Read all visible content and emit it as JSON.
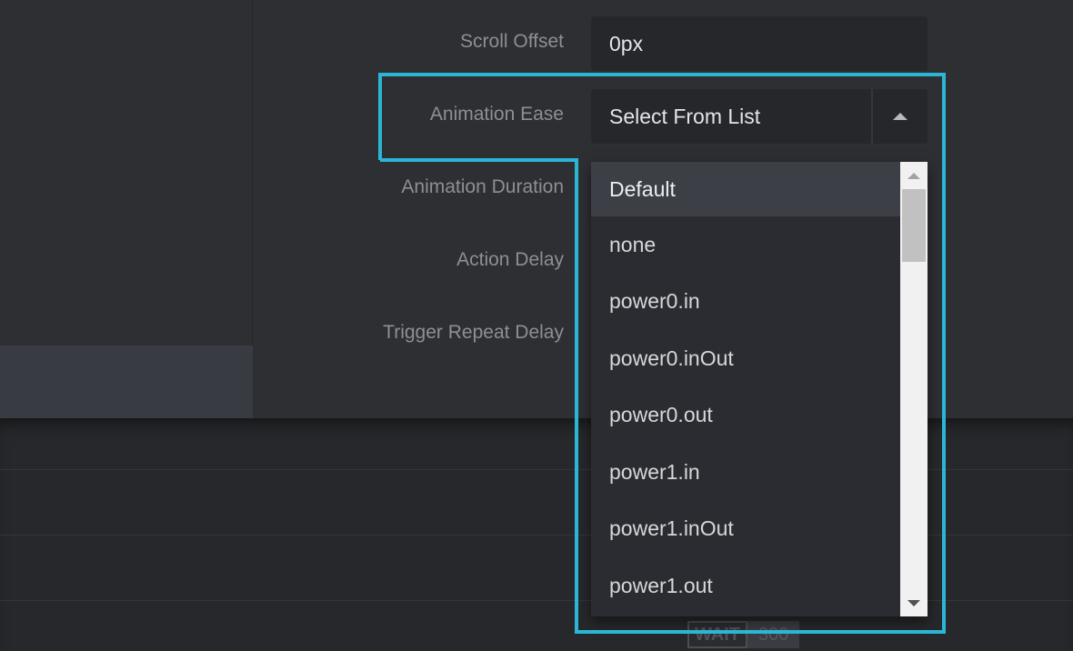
{
  "form": {
    "scroll_offset_label": "Scroll Offset",
    "scroll_offset_value": "0px",
    "animation_ease_label": "Animation Ease",
    "animation_ease_value": "Select From List",
    "animation_duration_label": "Animation Duration",
    "action_delay_label": "Action Delay",
    "trigger_repeat_delay_label": "Trigger Repeat Delay"
  },
  "dropdown": {
    "options": [
      "Default",
      "none",
      "power0.in",
      "power0.inOut",
      "power0.out",
      "power1.in",
      "power1.inOut",
      "power1.out"
    ],
    "active_index": 0
  },
  "timeline": {
    "wait_label": "WAIT",
    "wait_value": "300"
  },
  "colors": {
    "highlight": "#2bb6d6"
  }
}
